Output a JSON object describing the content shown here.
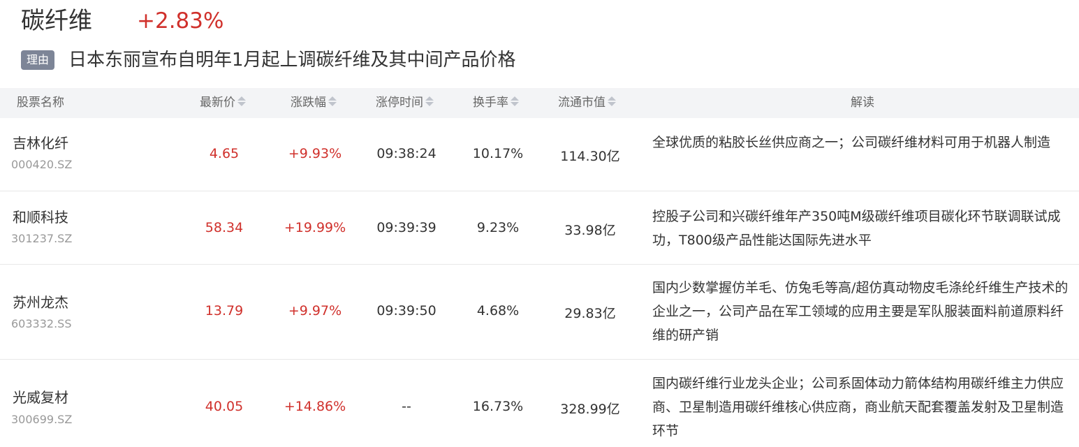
{
  "header": {
    "sector_name": "碳纤维",
    "sector_change": "+2.83%",
    "reason_badge": "理由",
    "reason_text": "日本东丽宣布自明年1月起上调碳纤维及其中间产品价格"
  },
  "table": {
    "columns": {
      "name": "股票名称",
      "price": "最新价",
      "change": "涨跌幅",
      "limit_time": "涨停时间",
      "turnover": "换手率",
      "market_cap": "流通市值",
      "analysis": "解读"
    },
    "rows": [
      {
        "name": "吉林化纤",
        "code": "000420.SZ",
        "price": "4.65",
        "change": "+9.93%",
        "limit_time": "09:38:24",
        "turnover": "10.17%",
        "market_cap": "114.30亿",
        "analysis": "全球优质的粘胶长丝供应商之一；公司碳纤维材料可用于机器人制造"
      },
      {
        "name": "和顺科技",
        "code": "301237.SZ",
        "price": "58.34",
        "change": "+19.99%",
        "limit_time": "09:39:39",
        "turnover": "9.23%",
        "market_cap": "33.98亿",
        "analysis": "控股子公司和兴碳纤维年产350吨M级碳纤维项目碳化环节联调联试成功，T800级产品性能达国际先进水平"
      },
      {
        "name": "苏州龙杰",
        "code": "603332.SS",
        "price": "13.79",
        "change": "+9.97%",
        "limit_time": "09:39:50",
        "turnover": "4.68%",
        "market_cap": "29.83亿",
        "analysis": "国内少数掌握仿羊毛、仿兔毛等高/超仿真动物皮毛涤纶纤维生产技术的企业之一，公司产品在军工领域的应用主要是军队服装面料前道原料纤维的研产销"
      },
      {
        "name": "光威复材",
        "code": "300699.SZ",
        "price": "40.05",
        "change": "+14.86%",
        "limit_time": "--",
        "turnover": "16.73%",
        "market_cap": "328.99亿",
        "analysis": "国内碳纤维行业龙头企业；公司系固体动力箭体结构用碳纤维主力供应商、卫星制造用碳纤维核心供应商，商业航天配套覆盖发射及卫星制造环节"
      }
    ]
  },
  "colors": {
    "up_red": "#d0302b",
    "badge_bg": "#7d8597",
    "header_bg": "#f3f4f6"
  },
  "icons": {
    "sort": "sort-caret-icon"
  }
}
